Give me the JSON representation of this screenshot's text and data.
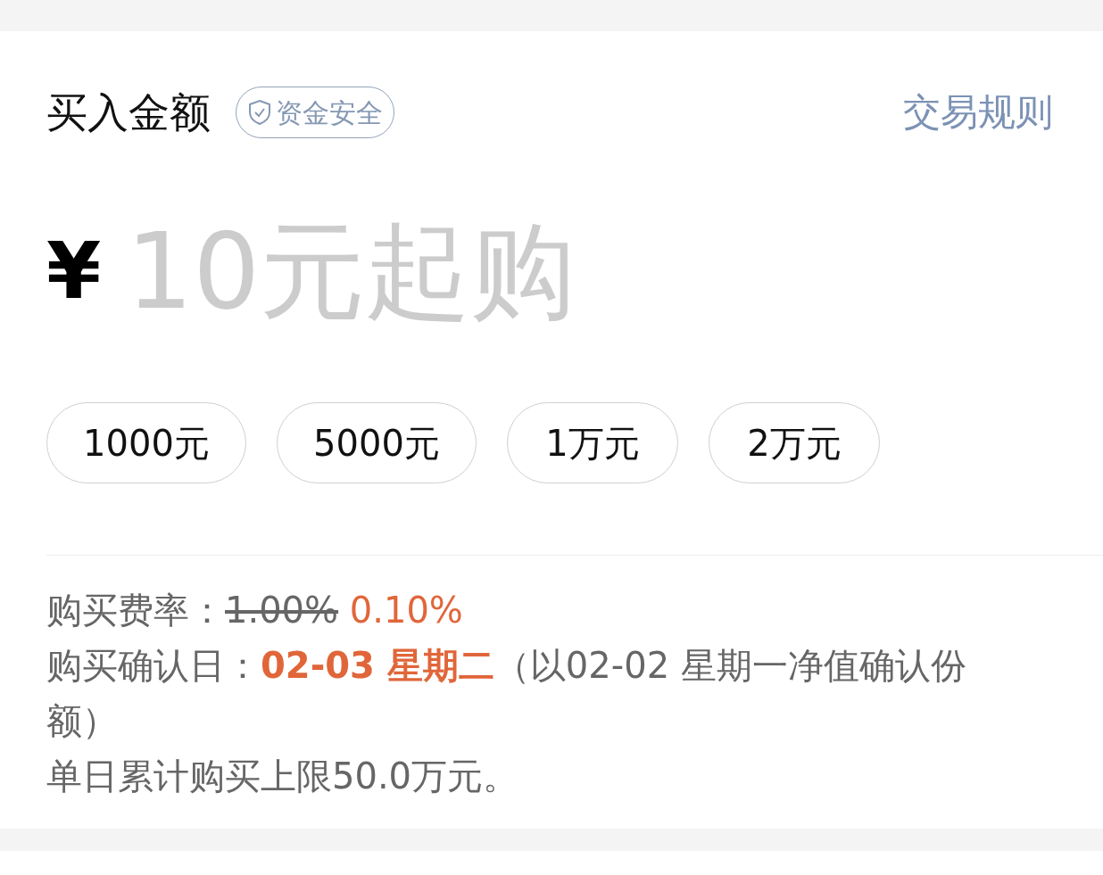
{
  "header": {
    "title": "买入金额",
    "badge": "资金安全",
    "link": "交易规则"
  },
  "amount": {
    "currency": "¥",
    "placeholder": "10元起购"
  },
  "presets": [
    {
      "label": "1000元"
    },
    {
      "label": "5000元"
    },
    {
      "label": "1万元"
    },
    {
      "label": "2万元"
    }
  ],
  "fee": {
    "label": "购买费率：",
    "original": "1.00%",
    "current": "0.10%"
  },
  "confirm": {
    "label": "购买确认日：",
    "date": "02-03 星期二",
    "note": "（以02-02 星期一净值确认份额）"
  },
  "limit": "单日累计购买上限50.0万元。"
}
